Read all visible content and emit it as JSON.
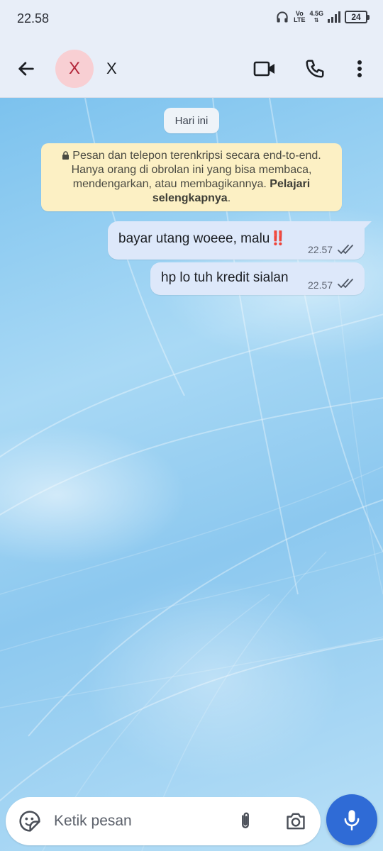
{
  "status_bar": {
    "time": "22.58",
    "network_vo": "Vo",
    "network_lte": "LTE",
    "network_gen": "4.5G",
    "battery_level": "24"
  },
  "header": {
    "avatar_initial": "X",
    "contact_name": "X",
    "icons": [
      "back-arrow-icon",
      "video-call-icon",
      "phone-icon",
      "more-vert-icon"
    ]
  },
  "chat": {
    "date_label": "Hari ini",
    "encryption_notice": {
      "text": "Pesan dan telepon terenkripsi secara end-to-end. Hanya orang di obrolan ini yang bisa membaca, mendengarkan, atau membagikannya.",
      "link_text": "Pelajari selengkapnya",
      "suffix": "."
    },
    "messages": [
      {
        "text": "bayar utang woeee, malu",
        "emoji": "‼️",
        "time": "22.57",
        "status": "delivered"
      },
      {
        "text": "hp lo tuh kredit sialan",
        "time": "22.57",
        "status": "delivered"
      }
    ]
  },
  "composer": {
    "placeholder": "Ketik pesan",
    "icons": [
      "sticker-icon",
      "attach-icon",
      "camera-icon",
      "mic-icon"
    ]
  },
  "colors": {
    "bar_bg": "#e8eef8",
    "bubble_out": "#dde8fa",
    "notice_bg": "#fcf0c4",
    "mic_button": "#2f6bd6",
    "avatar_bg": "#f8cfd3",
    "avatar_fg": "#b3263a"
  }
}
